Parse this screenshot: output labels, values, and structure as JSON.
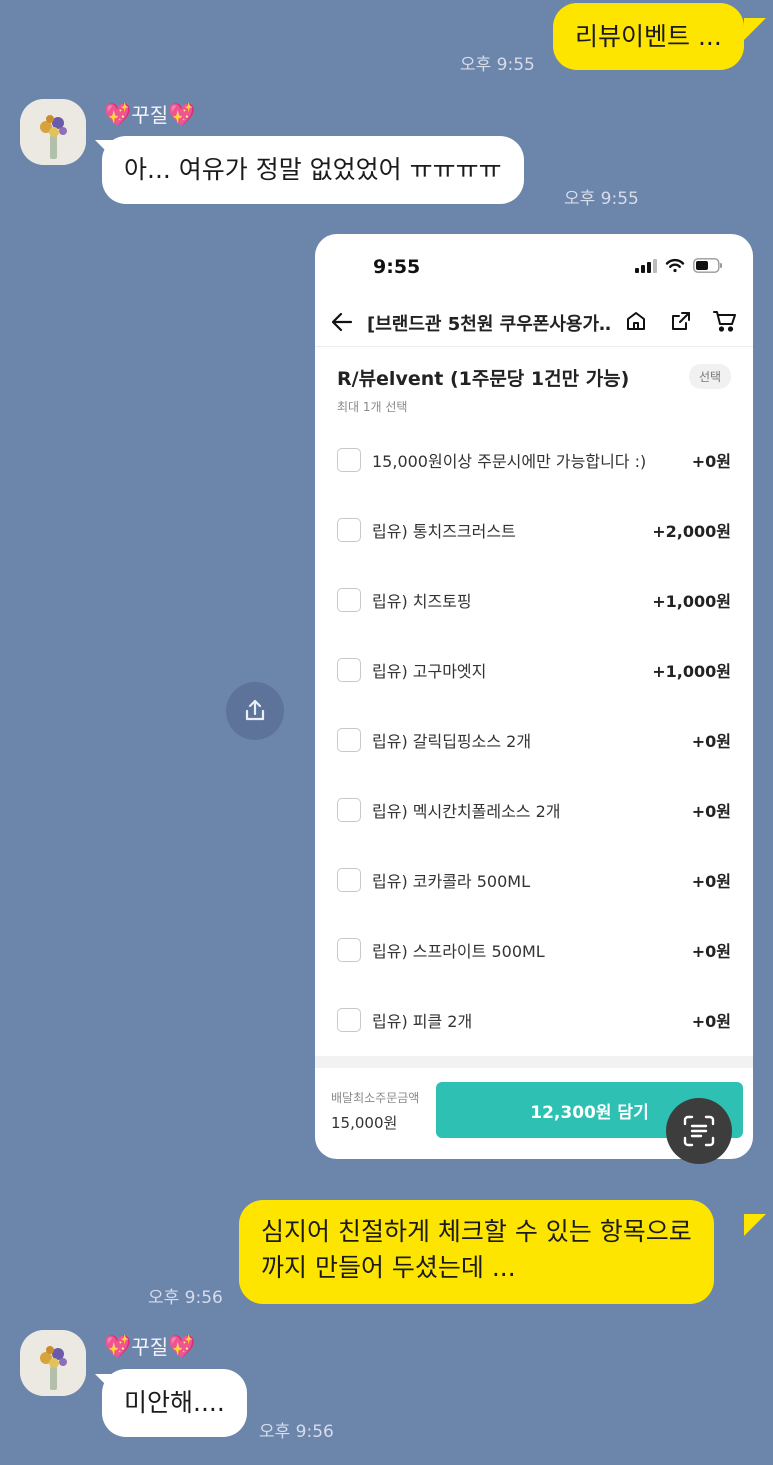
{
  "messages": {
    "m1": {
      "text": "리뷰이벤트 ...",
      "time": "오후 9:55"
    },
    "m2": {
      "sender": "꾸질",
      "text": "아... 여유가 정말 없었었어 ㅠㅠㅠㅠ",
      "time": "오후 9:55"
    },
    "m4": {
      "line1": "심지어 친절하게 체크할 수 있는 항목으로",
      "line2": "까지 만들어 두셨는데 ...",
      "time": "오후 9:56"
    },
    "m5": {
      "sender": "꾸질",
      "text": "미안해....",
      "time": "오후 9:56"
    }
  },
  "icons": {
    "heart": "sparkling-heart-icon",
    "share": "share-icon",
    "scan": "text-scan-icon"
  },
  "screenshot": {
    "clock": "9:55",
    "nav_title": "[브랜드관 5천원 쿠우폰사용가…",
    "option_title": "R/뷰elvent (1주문당 1건만 가능)",
    "option_sub": "최대 1개 선택",
    "option_badge": "선택",
    "items": [
      {
        "label": "15,000원이상 주문시에만 가능합니다 :)",
        "price": "+0원"
      },
      {
        "label": "립유) 통치즈크러스트",
        "price": "+2,000원"
      },
      {
        "label": "립유) 치즈토핑",
        "price": "+1,000원"
      },
      {
        "label": "립유) 고구마엣지",
        "price": "+1,000원"
      },
      {
        "label": "립유) 갈릭딥핑소스 2개",
        "price": "+0원"
      },
      {
        "label": "립유) 멕시칸치폴레소스 2개",
        "price": "+0원"
      },
      {
        "label": "립유) 코카콜라 500ML",
        "price": "+0원"
      },
      {
        "label": "립유) 스프라이트 500ML",
        "price": "+0원"
      },
      {
        "label": "립유) 피클 2개",
        "price": "+0원"
      }
    ],
    "min_order_label": "배달최소주문금액",
    "min_order_value": "15,000원",
    "cart_button": "12,300원 담기"
  },
  "colors": {
    "chat_background": "#6c85ab",
    "my_bubble": "#fee500",
    "their_bubble": "#ffffff",
    "cart_button": "#2ec1b3"
  }
}
